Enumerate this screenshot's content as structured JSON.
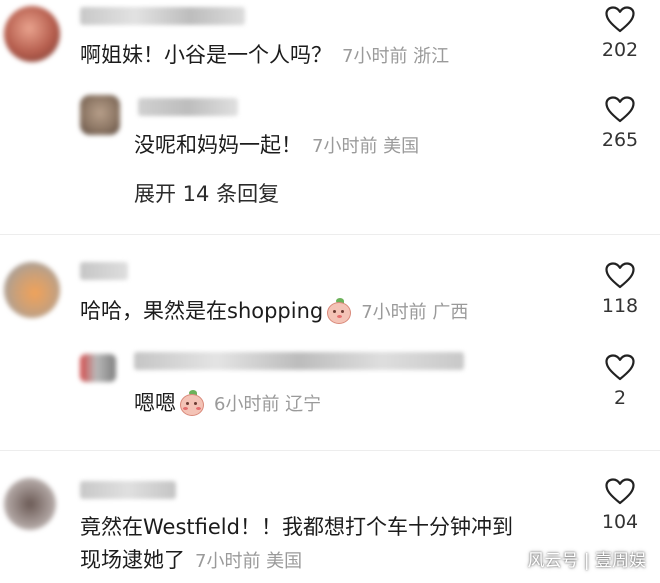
{
  "comments": [
    {
      "text": "啊姐妹！小谷是一个人吗？",
      "meta": "7小时前 浙江",
      "likes": "202",
      "reply": {
        "text": "没呢和妈妈一起！",
        "meta": "7小时前 美国",
        "likes": "265"
      },
      "expand_label": "展开 14 条回复"
    },
    {
      "text": "哈哈，果然是在shopping",
      "meta": "7小时前 广西",
      "likes": "118",
      "reply": {
        "text": "嗯嗯",
        "meta": "6小时前 辽宁",
        "likes": "2"
      }
    },
    {
      "text_line1": "竟然在Westfield！！我都想打个车十分钟冲到",
      "text_line2": "现场逮她了",
      "meta": "7小时前 美国",
      "likes": "104"
    }
  ],
  "watermark": "风云号 | 壹周娱",
  "colors": {
    "meta": "#9a9a9a",
    "text": "#1c1c1c",
    "divider": "#ededed"
  }
}
